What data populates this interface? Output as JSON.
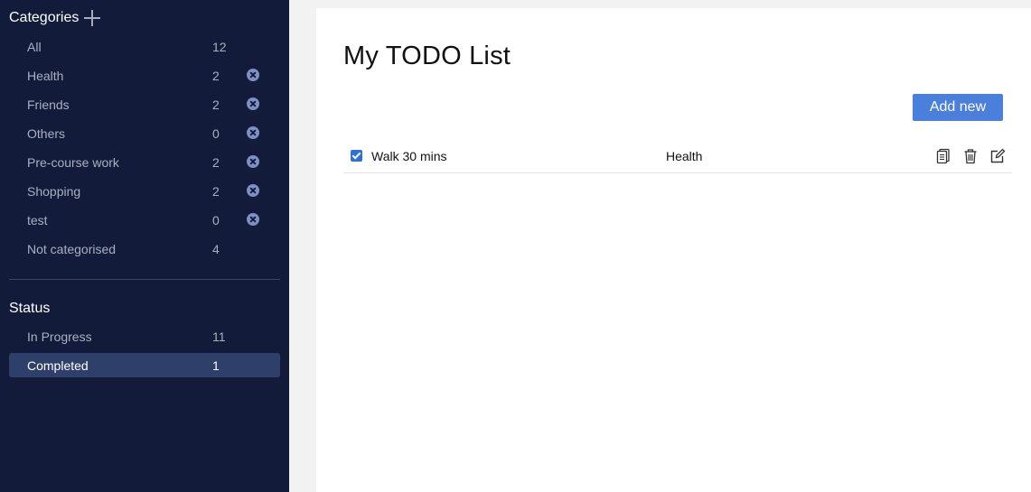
{
  "sidebar": {
    "categories_title": "Categories",
    "categories": [
      {
        "label": "All",
        "count": "12"
      },
      {
        "label": "Health",
        "count": "2"
      },
      {
        "label": "Friends",
        "count": "2"
      },
      {
        "label": "Others",
        "count": "0"
      },
      {
        "label": "Pre-course work",
        "count": "2"
      },
      {
        "label": "Shopping",
        "count": "2"
      },
      {
        "label": "test",
        "count": "0"
      },
      {
        "label": "Not categorised",
        "count": "4"
      }
    ],
    "status_title": "Status",
    "statuses": [
      {
        "label": "In Progress",
        "count": "11"
      },
      {
        "label": "Completed",
        "count": "1",
        "active": true
      }
    ]
  },
  "main": {
    "title": "My TODO List",
    "add_button": "Add new",
    "todos": [
      {
        "text": "Walk 30 mins",
        "category": "Health",
        "done": true
      }
    ]
  },
  "icons": {
    "add_category": "plus-icon",
    "remove_category": "close-circle-icon",
    "copy": "copy-icon",
    "delete": "trash-icon",
    "edit": "edit-icon"
  },
  "colors": {
    "sidebar_bg": "#121c3a",
    "active_item_bg": "#2e3f6a",
    "accent": "#4a7fdc"
  }
}
